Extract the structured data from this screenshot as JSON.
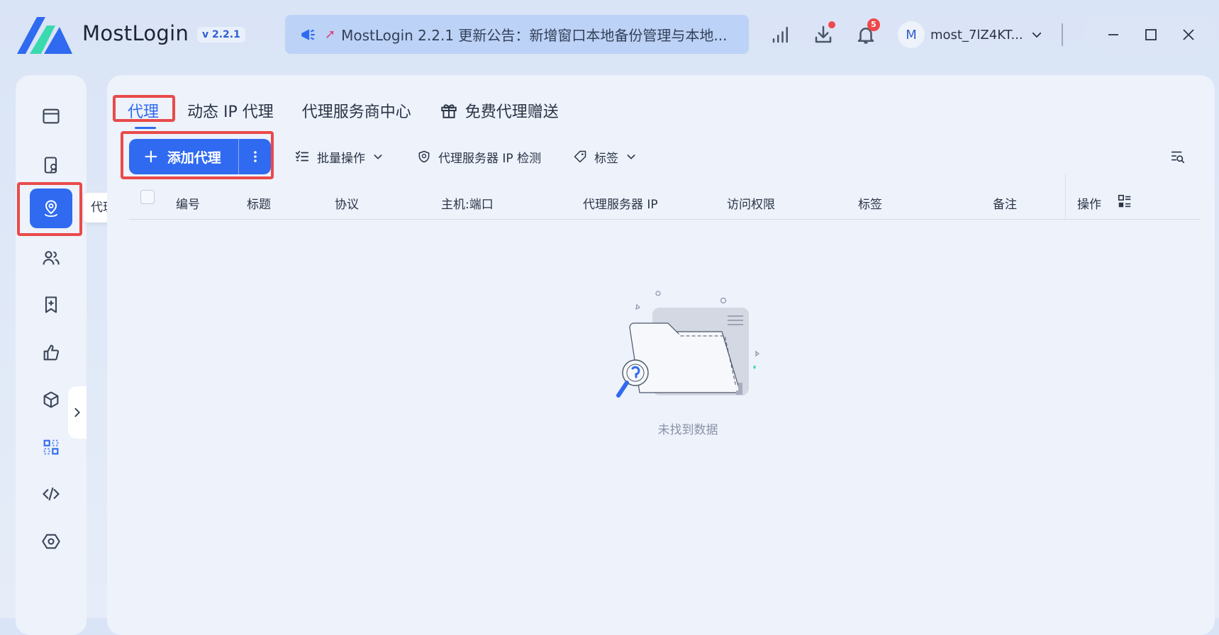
{
  "app": {
    "name": "MostLogin",
    "version": "v 2.2.1",
    "announcement": "MostLogin 2.2.1 更新公告：新增窗口本地备份管理与本地...",
    "notification_count": "5",
    "user_initial": "M",
    "username": "most_7lZ4KT..."
  },
  "sidebar": {
    "tooltip": "代理",
    "items": [
      "browser",
      "profile",
      "proxy",
      "team",
      "bookmark",
      "like",
      "package",
      "apps",
      "code",
      "settings"
    ]
  },
  "tabs": [
    {
      "label": "代理",
      "active": true
    },
    {
      "label": "动态 IP 代理",
      "active": false
    },
    {
      "label": "代理服务商中心",
      "active": false
    },
    {
      "label": "免费代理赠送",
      "active": false
    }
  ],
  "toolbar": {
    "add_label": "添加代理",
    "batch_label": "批量操作",
    "check_label": "代理服务器 IP 检测",
    "tag_label": "标签"
  },
  "table": {
    "columns": [
      "编号",
      "标题",
      "协议",
      "主机:端口",
      "代理服务器 IP",
      "访问权限",
      "标签",
      "备注",
      "操作"
    ]
  },
  "empty_state": {
    "text": "未找到数据"
  },
  "colors": {
    "accent": "#2f6af0",
    "highlight": "#e94a4a",
    "badge": "#f0474a"
  }
}
